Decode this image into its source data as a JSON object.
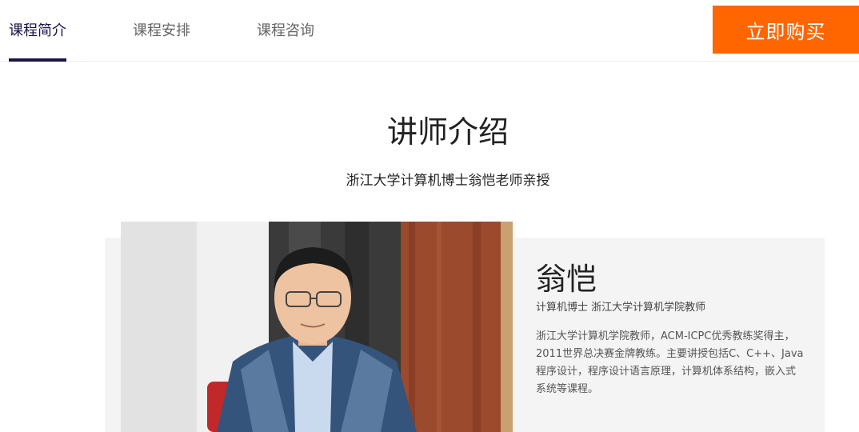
{
  "nav": {
    "tabs": [
      {
        "label": "课程简介",
        "active": true
      },
      {
        "label": "课程安排",
        "active": false
      },
      {
        "label": "课程咨询",
        "active": false
      }
    ],
    "buy_label": "立即购买"
  },
  "colors": {
    "accent": "#ff6600",
    "active_tab": "#1a1446",
    "card_bg": "#f4f4f4"
  },
  "section": {
    "title": "讲师介绍",
    "subtitle": "浙江大学计算机博士翁恺老师亲授"
  },
  "teacher": {
    "name": "翁恺",
    "title": "计算机博士 浙江大学计算机学院教师",
    "bio": "浙江大学计算机学院教师，ACM-ICPC优秀教练奖得主，2011世界总决赛金牌教练。主要讲授包括C、C++、Java程序设计，程序设计语言原理，计算机体系结构，嵌入式系统等课程。"
  }
}
